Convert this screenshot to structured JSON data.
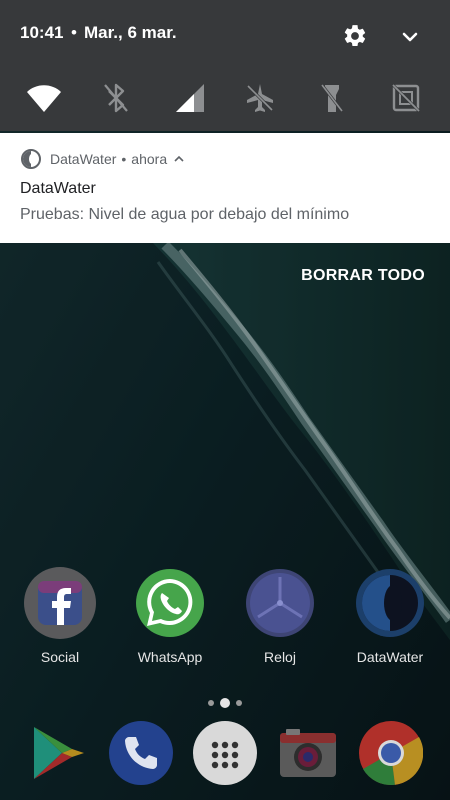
{
  "status": {
    "time": "10:41",
    "separator": "•",
    "date": "Mar., 6 mar."
  },
  "quick_tiles": [
    {
      "icon": "wifi-icon",
      "state": "on"
    },
    {
      "icon": "bluetooth-icon",
      "state": "off"
    },
    {
      "icon": "signal-icon",
      "state": "on"
    },
    {
      "icon": "airplane-icon",
      "state": "off"
    },
    {
      "icon": "flashlight-icon",
      "state": "off"
    },
    {
      "icon": "auto-rotate-icon",
      "state": "off"
    }
  ],
  "notification": {
    "app_name": "DataWater",
    "separator": "•",
    "time": "ahora",
    "title": "DataWater",
    "body": "Pruebas: Nivel de agua por debajo del mínimo"
  },
  "clear_all_label": "BORRAR TODO",
  "home_apps": [
    {
      "label": "Social",
      "icon": "facebook-icon"
    },
    {
      "label": "WhatsApp",
      "icon": "whatsapp-icon"
    },
    {
      "label": "Reloj",
      "icon": "clock-icon"
    },
    {
      "label": "DataWater",
      "icon": "datawater-icon"
    }
  ],
  "dock": [
    {
      "icon": "play-store-icon"
    },
    {
      "icon": "phone-icon"
    },
    {
      "icon": "app-drawer-icon"
    },
    {
      "icon": "camera-icon"
    },
    {
      "icon": "chrome-icon"
    }
  ],
  "colors": {
    "shade": "#37393b",
    "notification_bg": "#ffffff",
    "water_dark": "#0b1a1f",
    "foam": "#cfe3e3"
  }
}
